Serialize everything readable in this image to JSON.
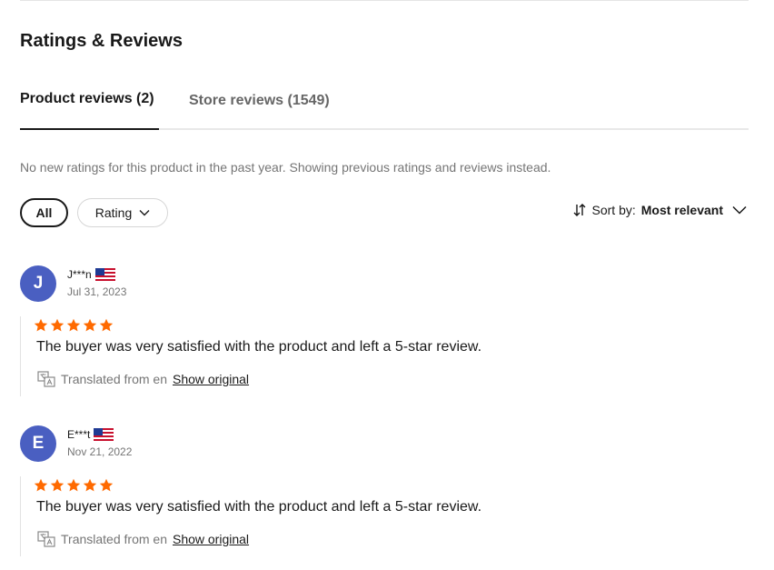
{
  "section": {
    "title": "Ratings & Reviews"
  },
  "tabs": [
    {
      "label": "Product reviews (2)",
      "active": true
    },
    {
      "label": "Store reviews (1549)",
      "active": false
    }
  ],
  "notice": "No new ratings for this product in the past year. Showing previous ratings and reviews instead.",
  "filters": {
    "all_label": "All",
    "rating_label": "Rating"
  },
  "sort": {
    "prefix": "Sort by:",
    "value": "Most relevant"
  },
  "colors": {
    "star": "#ff6a00",
    "avatar": "#4a5fc1"
  },
  "reviews": [
    {
      "initial": "J",
      "name": "J***n",
      "flag": "us-flag-icon",
      "date": "Jul 31, 2023",
      "stars": 5,
      "text": "The buyer was very satisfied with the product and left a 5-star review.",
      "translated": "Translated from en",
      "show_original": "Show original"
    },
    {
      "initial": "E",
      "name": "E***t",
      "flag": "us-flag-icon",
      "date": "Nov 21, 2022",
      "stars": 5,
      "text": "The buyer was very satisfied with the product and left a 5-star review.",
      "translated": "Translated from en",
      "show_original": "Show original"
    }
  ]
}
